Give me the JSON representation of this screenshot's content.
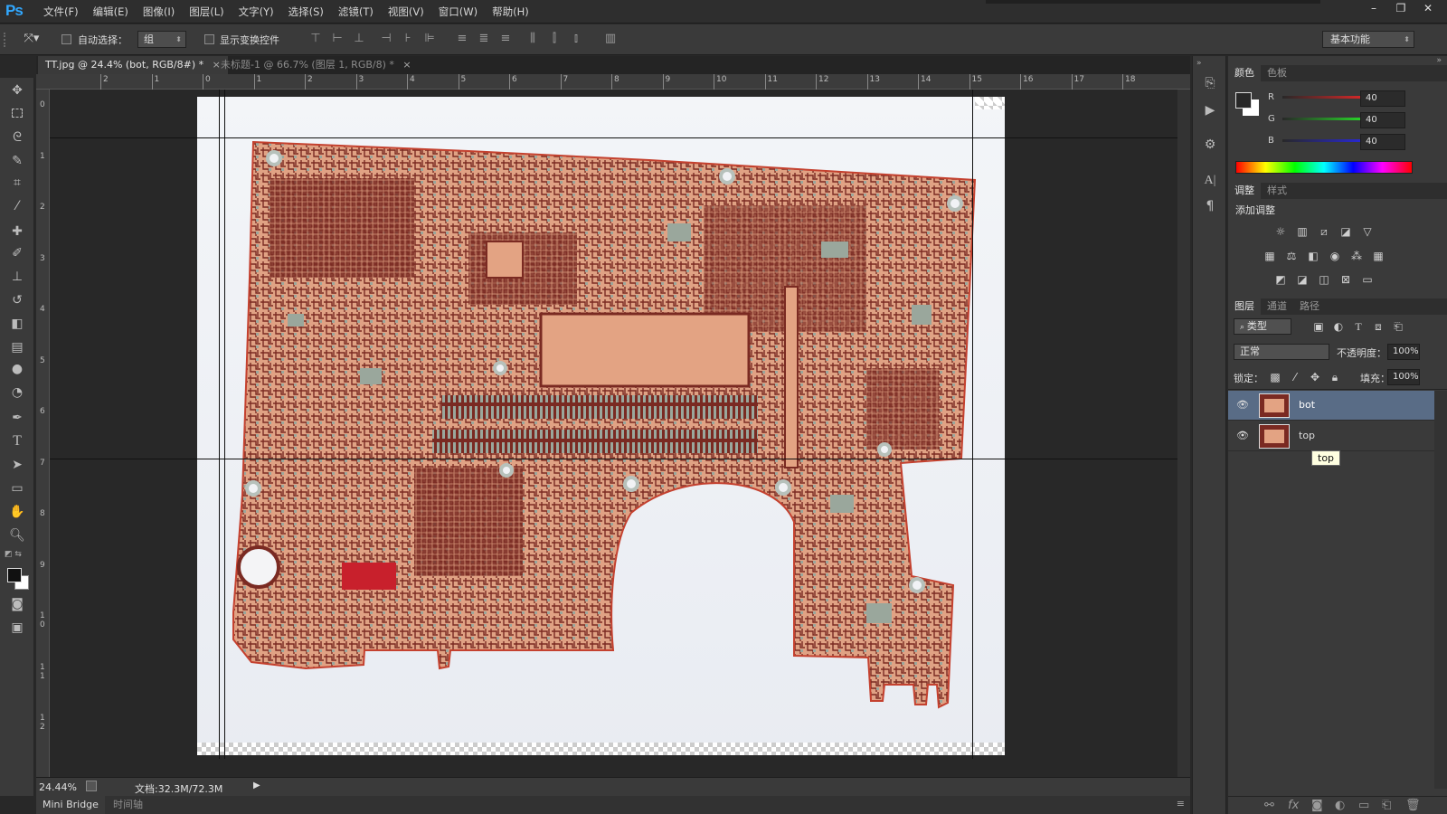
{
  "app": {
    "logo": "Ps"
  },
  "menu": [
    "文件(F)",
    "编辑(E)",
    "图像(I)",
    "图层(L)",
    "文字(Y)",
    "选择(S)",
    "滤镜(T)",
    "视图(V)",
    "窗口(W)",
    "帮助(H)"
  ],
  "window_controls": {
    "minimize": "–",
    "restore": "❐",
    "close": "✕"
  },
  "options": {
    "auto_select_label": "自动选择：",
    "auto_select_value": "组",
    "transform_label": "显示变换控件",
    "workspace": "基本功能"
  },
  "tabs": [
    {
      "label": "TT.jpg @ 24.4% (bot, RGB/8#) *",
      "close": "×"
    },
    {
      "label": "未标题-1 @ 66.7% (图层 1, RGB/8) *",
      "close": "×"
    }
  ],
  "ruler": {
    "h": [
      "2",
      "1",
      "0",
      "1",
      "2",
      "3",
      "4",
      "5",
      "6",
      "7",
      "8",
      "9",
      "10",
      "11",
      "12",
      "13",
      "14",
      "15",
      "16",
      "17",
      "18"
    ],
    "v": [
      "0",
      "1",
      "2",
      "3",
      "4",
      "5",
      "6",
      "7",
      "8",
      "9",
      "1\n0",
      "1\n1",
      "1\n2"
    ]
  },
  "status": {
    "zoom": "24.44%",
    "doc": "文档:32.3M/72.3M"
  },
  "bottom_tabs": [
    "Mini Bridge",
    "时间轴"
  ],
  "color_panel": {
    "tabs": [
      "颜色",
      "色板"
    ],
    "channels": [
      {
        "name": "R",
        "value": "40"
      },
      {
        "name": "G",
        "value": "40"
      },
      {
        "name": "B",
        "value": "40"
      }
    ]
  },
  "adjust_panel": {
    "tabs": [
      "调整",
      "样式"
    ],
    "title": "添加调整"
  },
  "layers_panel": {
    "tabs": [
      "图层",
      "通道",
      "路径"
    ],
    "filter": "类型",
    "blend": "正常",
    "opacity_label": "不透明度：",
    "opacity": "100%",
    "lock_label": "锁定：",
    "fill_label": "填充：",
    "fill": "100%",
    "layers": [
      {
        "name": "bot",
        "selected": true
      },
      {
        "name": "top",
        "selected": false
      }
    ],
    "tooltip": "top"
  },
  "colors": {
    "accent": "#31a8ff",
    "board_dark": "#7a2a22",
    "board_copper": "#e3a383",
    "pad": "#9aa79c",
    "selected_layer": "#596c86"
  }
}
